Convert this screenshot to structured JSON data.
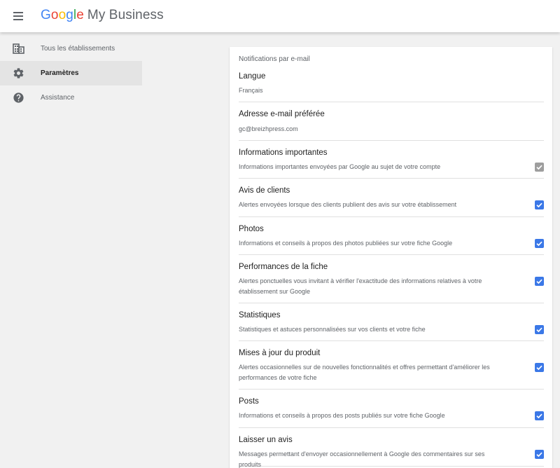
{
  "app": {
    "logo_letters": [
      "G",
      "o",
      "o",
      "g",
      "l",
      "e"
    ],
    "product_name": "My Business"
  },
  "sidebar": {
    "items": [
      {
        "label": "Tous les établissements",
        "icon": "building-icon",
        "active": false
      },
      {
        "label": "Paramètres",
        "icon": "gear-icon",
        "active": true
      },
      {
        "label": "Assistance",
        "icon": "help-icon",
        "active": false
      }
    ]
  },
  "settings": {
    "header": "Notifications par e-mail",
    "language": {
      "title": "Langue",
      "value": "Français"
    },
    "email": {
      "title": "Adresse e-mail préférée",
      "value": "gc@breizhpress.com"
    },
    "notifications": [
      {
        "title": "Informations importantes",
        "description": "Informations importantes envoyées par Google au sujet de votre compte",
        "checked": true,
        "disabled": true
      },
      {
        "title": "Avis de clients",
        "description": "Alertes envoyées lorsque des clients publient des avis sur votre établissement",
        "checked": true,
        "disabled": false
      },
      {
        "title": "Photos",
        "description": "Informations et conseils à propos des photos publiées sur votre fiche Google",
        "checked": true,
        "disabled": false
      },
      {
        "title": "Performances de la fiche",
        "description": "Alertes ponctuelles vous invitant à vérifier l'exactitude des informations relatives à votre établissement sur Google",
        "checked": true,
        "disabled": false
      },
      {
        "title": "Statistiques",
        "description": "Statistiques et astuces personnalisées sur vos clients et votre fiche",
        "checked": true,
        "disabled": false
      },
      {
        "title": "Mises à jour du produit",
        "description": "Alertes occasionnelles sur de nouvelles fonctionnalités et offres permettant d'améliorer les performances de votre fiche",
        "checked": true,
        "disabled": false
      },
      {
        "title": "Posts",
        "description": "Informations et conseils à propos des posts publiés sur votre fiche Google",
        "checked": true,
        "disabled": false
      },
      {
        "title": "Laisser un avis",
        "description": "Messages permettant d'envoyer occasionnellement à Google des commentaires sur ses produits",
        "checked": true,
        "disabled": false
      }
    ]
  },
  "colors": {
    "checkbox_checked": "#3b78e7",
    "checkbox_disabled": "#9e9e9e",
    "active_nav_bg": "#e4e4e4"
  }
}
